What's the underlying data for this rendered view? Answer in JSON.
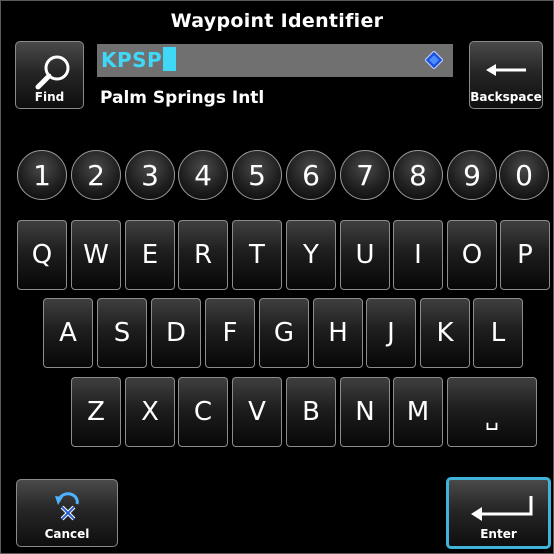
{
  "title": "Waypoint Identifier",
  "find": {
    "label": "Find",
    "icon": "magnifier-icon"
  },
  "backspace": {
    "label": "Backspace",
    "icon": "left-arrow-icon"
  },
  "identifier": {
    "value": "KPSP",
    "name": "Palm Springs Intl",
    "icon": "waypoint-diamond-icon"
  },
  "number_keys": [
    "1",
    "2",
    "3",
    "4",
    "5",
    "6",
    "7",
    "8",
    "9",
    "0"
  ],
  "row1": [
    "Q",
    "W",
    "E",
    "R",
    "T",
    "Y",
    "U",
    "I",
    "O",
    "P"
  ],
  "row2": [
    "A",
    "S",
    "D",
    "F",
    "G",
    "H",
    "J",
    "K",
    "L"
  ],
  "row3": [
    "Z",
    "X",
    "C",
    "V",
    "B",
    "N",
    "M"
  ],
  "space_key": {
    "label": "␣",
    "icon": "space-icon"
  },
  "cancel": {
    "label": "Cancel",
    "icon": "cancel-icon"
  },
  "enter": {
    "label": "Enter",
    "icon": "enter-arrow-icon"
  },
  "colors": {
    "text_cyan": "#3fd8f6",
    "field_bg": "#707070",
    "enter_border": "#3fb4d8"
  }
}
